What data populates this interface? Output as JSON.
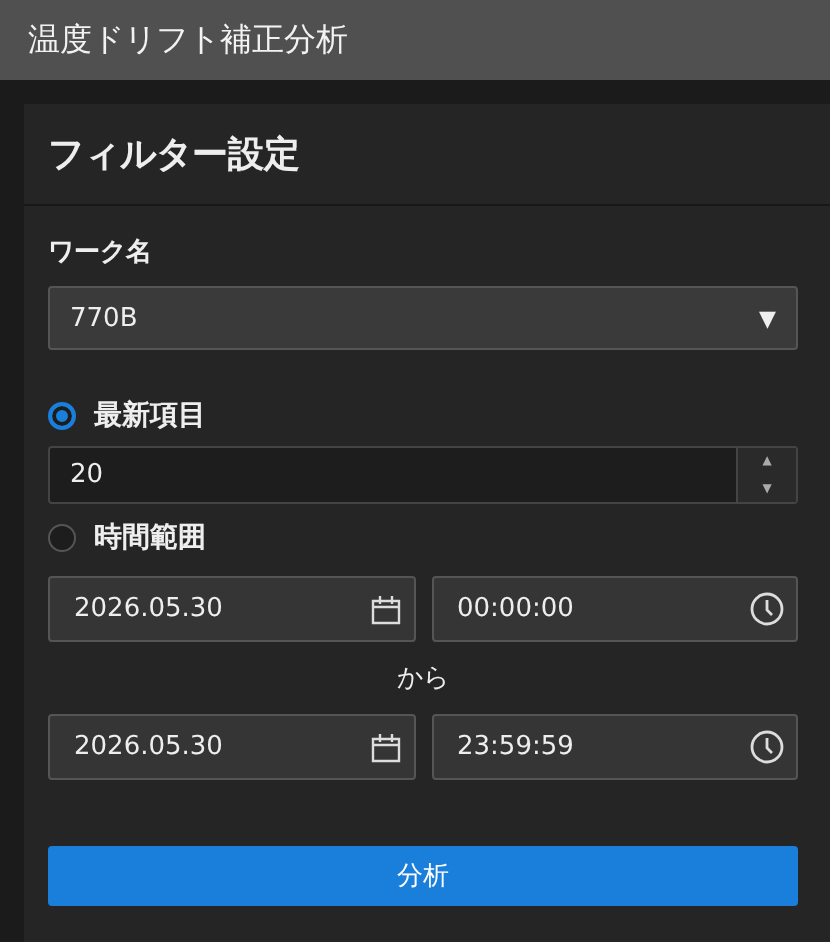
{
  "window": {
    "title": "温度ドリフト補正分析"
  },
  "panel": {
    "title": "フィルター設定",
    "work": {
      "label": "ワーク名",
      "value": "770B",
      "caret": "▼"
    },
    "modes": [
      {
        "label": "最新項目",
        "selected": true
      },
      {
        "label": "時間範囲",
        "selected": false
      }
    ],
    "count": {
      "value": "20",
      "up": "▲",
      "down": "▼"
    },
    "range": {
      "start_date": "2026.05.30",
      "start_time": "00:00:00",
      "separator": "から",
      "end_date": "2026.05.30",
      "end_time": "23:59:59"
    },
    "button": "分析"
  }
}
